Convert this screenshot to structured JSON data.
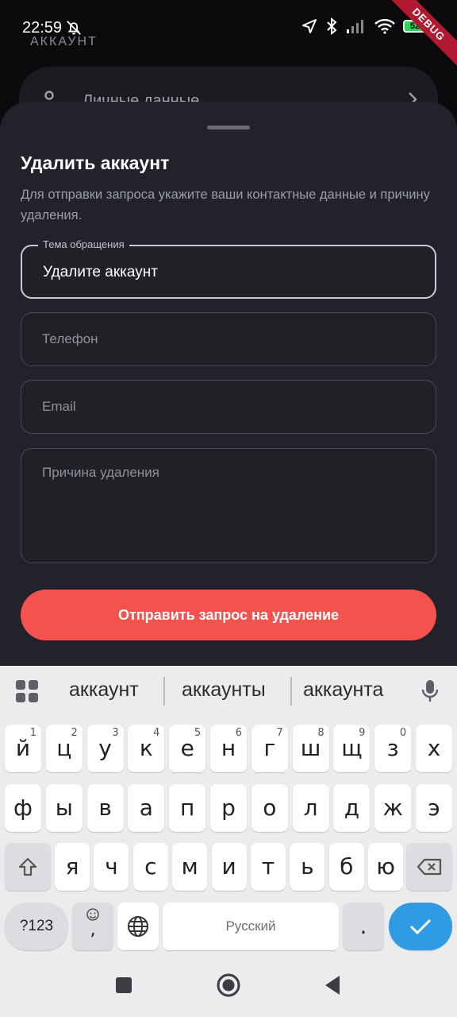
{
  "status_bar": {
    "time": "22:59",
    "battery": "52",
    "debug_label": "DEBUG"
  },
  "background": {
    "section_label": "АККАУНТ",
    "card_label": "Личные данные"
  },
  "sheet": {
    "title": "Удалить аккаунт",
    "description": "Для отправки запроса укажите ваши контактные данные и причину удаления.",
    "subject_field": {
      "label": "Тема обращения",
      "value": "Удалите аккаунт"
    },
    "phone_field": {
      "placeholder": "Телефон"
    },
    "email_field": {
      "placeholder": "Email"
    },
    "reason_field": {
      "placeholder": "Причина удаления"
    },
    "submit_label": "Отправить запрос на удаление"
  },
  "keyboard": {
    "suggestions": [
      "аккаунт",
      "аккаунты",
      "аккаунта"
    ],
    "row1": [
      {
        "k": "й",
        "n": "1"
      },
      {
        "k": "ц",
        "n": "2"
      },
      {
        "k": "у",
        "n": "3"
      },
      {
        "k": "к",
        "n": "4"
      },
      {
        "k": "е",
        "n": "5"
      },
      {
        "k": "н",
        "n": "6"
      },
      {
        "k": "г",
        "n": "7"
      },
      {
        "k": "ш",
        "n": "8"
      },
      {
        "k": "щ",
        "n": "9"
      },
      {
        "k": "з",
        "n": "0"
      },
      {
        "k": "х",
        "n": ""
      }
    ],
    "row2": [
      "ф",
      "ы",
      "в",
      "а",
      "п",
      "р",
      "о",
      "л",
      "д",
      "ж",
      "э"
    ],
    "row3": [
      "я",
      "ч",
      "с",
      "м",
      "и",
      "т",
      "ь",
      "б",
      "ю"
    ],
    "symbols_label": "?123",
    "comma_label": ",",
    "space_label": "Русский",
    "period_label": "."
  },
  "colors": {
    "accent": "#f4524f",
    "sheet_bg": "#22232a",
    "keyboard_bg": "#ebeced",
    "enter_key": "#2f9be4"
  }
}
